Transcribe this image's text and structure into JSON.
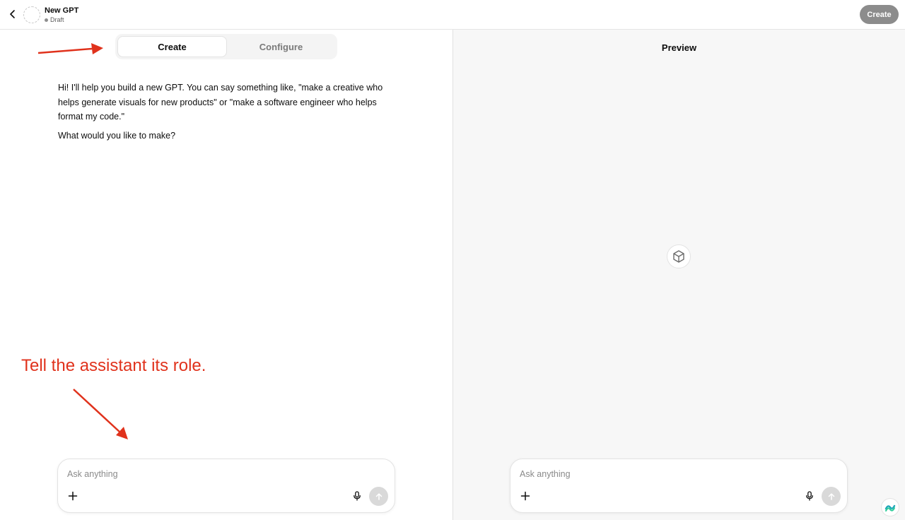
{
  "header": {
    "title": "New GPT",
    "status": "Draft",
    "create_label": "Create"
  },
  "builder": {
    "tabs": [
      {
        "label": "Create",
        "active": true
      },
      {
        "label": "Configure",
        "active": false
      }
    ],
    "messages": [
      "Hi! I'll help you build a new GPT. You can say something like, \"make a creative who helps generate visuals for new products\" or \"make a software engineer who helps format my code.\"",
      "What would you like to make?"
    ],
    "composer": {
      "placeholder": "Ask anything",
      "value": ""
    }
  },
  "annotations": {
    "hint_text": "Tell the assistant its role.",
    "color": "#e0321c"
  },
  "preview": {
    "title": "Preview",
    "composer": {
      "placeholder": "Ask anything",
      "value": ""
    }
  },
  "icons": {
    "back": "chevron-left-icon",
    "avatar": "dashed-circle-icon",
    "preview_placeholder": "cube-icon",
    "plus": "plus-icon",
    "mic": "microphone-icon",
    "send": "arrow-up-icon",
    "widget": "assistant-widget-icon"
  }
}
